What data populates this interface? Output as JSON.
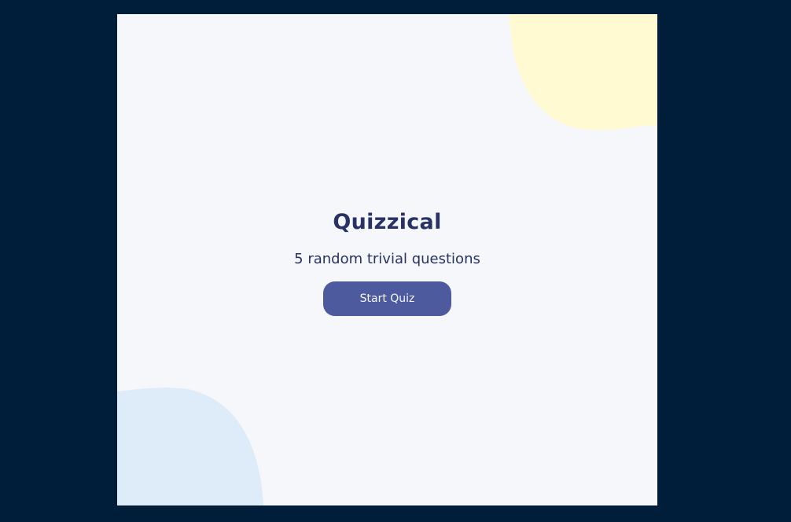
{
  "app": {
    "title": "Quizzical",
    "subtitle": "5 random trivial questions",
    "start_button_label": "Start Quiz"
  },
  "colors": {
    "page_background": "#001e39",
    "card_background": "#f5f7fb",
    "text": "#293264",
    "button": "#4d5b9e",
    "button_text": "#f5f7fb",
    "blob_yellow": "#fffad1",
    "blob_blue": "#deebf8"
  }
}
